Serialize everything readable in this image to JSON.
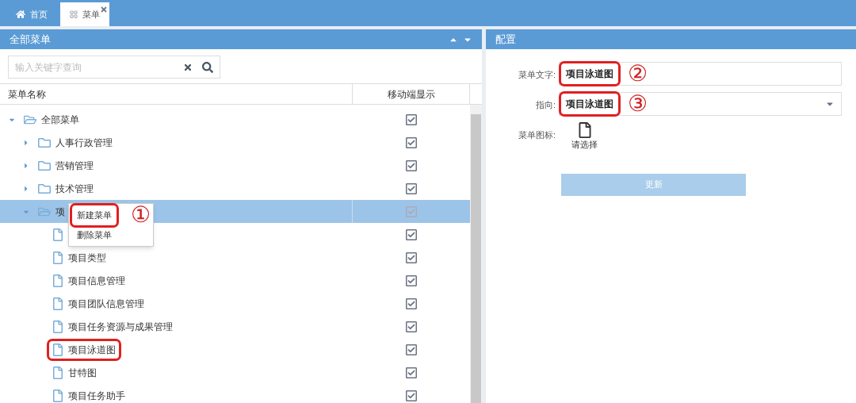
{
  "tabs": [
    {
      "label": "首页",
      "selected": false,
      "closable": false
    },
    {
      "label": "菜单",
      "selected": true,
      "closable": true
    }
  ],
  "menu_panel": {
    "title": "全部菜单",
    "search": {
      "placeholder": "输入关键字查询"
    },
    "columns": [
      "菜单名称",
      "移动端显示"
    ],
    "tree": [
      {
        "label": "全部菜单",
        "kind": "folder",
        "expanded": true,
        "selected": false,
        "mobile": true,
        "children": [
          {
            "label": "人事行政管理",
            "kind": "folder",
            "expanded": false,
            "selected": false,
            "mobile": true,
            "highlighted": false
          },
          {
            "label": "营销管理",
            "kind": "folder",
            "expanded": false,
            "selected": false,
            "mobile": true,
            "highlighted": false
          },
          {
            "label": "技术管理",
            "kind": "folder",
            "expanded": false,
            "selected": false,
            "mobile": true,
            "highlighted": false
          },
          {
            "label": "项",
            "kind": "folder",
            "expanded": true,
            "selected": true,
            "mobile": true,
            "highlighted": false,
            "children": [
              {
                "kind": "file",
                "selected": false,
                "mobile": true,
                "highlighted": false
              },
              {
                "label": "项目类型",
                "kind": "file",
                "selected": false,
                "mobile": true,
                "highlighted": false
              },
              {
                "label": "项目信息管理",
                "kind": "file",
                "selected": false,
                "mobile": true,
                "highlighted": false
              },
              {
                "label": "项目团队信息管理",
                "kind": "file",
                "selected": false,
                "mobile": true,
                "highlighted": false
              },
              {
                "label": "项目任务资源与成果管理",
                "kind": "file",
                "selected": false,
                "mobile": true,
                "highlighted": false
              },
              {
                "label": "项目泳道图",
                "kind": "file",
                "selected": false,
                "mobile": true,
                "highlighted": true
              },
              {
                "label": "甘特图",
                "kind": "file",
                "selected": false,
                "mobile": true,
                "highlighted": false
              },
              {
                "label": "项目任务助手",
                "kind": "file",
                "selected": false,
                "mobile": true,
                "highlighted": false
              }
            ]
          }
        ]
      }
    ],
    "context_menu": {
      "items": [
        {
          "label": "新建菜单",
          "highlighted": true,
          "marker": "①"
        },
        {
          "label": "删除菜单",
          "highlighted": false
        }
      ]
    }
  },
  "config_panel": {
    "title": "配置",
    "fields": [
      {
        "kind": "text",
        "label": "菜单文字:",
        "value": "项目泳道图",
        "highlighted": true,
        "marker": "②"
      },
      {
        "kind": "select",
        "label": "指向:",
        "value": "项目泳道图",
        "highlighted": true,
        "marker": "③"
      },
      {
        "kind": "icon",
        "label": "菜单图标:",
        "value": "请选择"
      }
    ],
    "button": {
      "label": "更新",
      "disabled": true
    }
  }
}
